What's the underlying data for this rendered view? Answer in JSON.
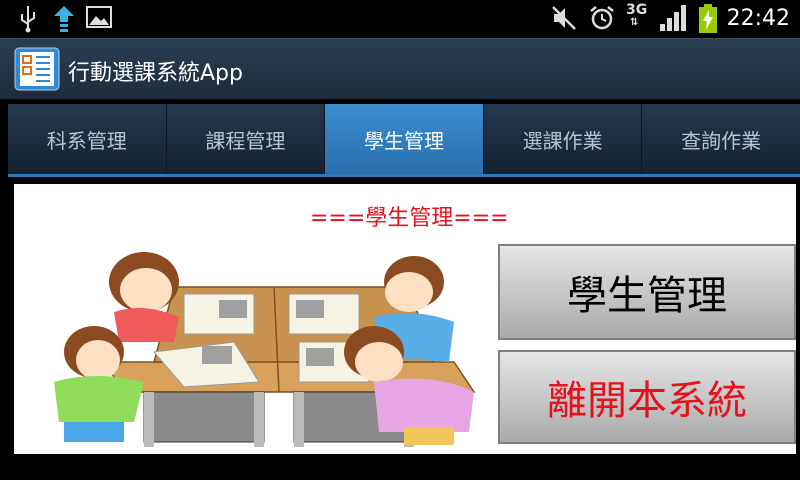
{
  "status_bar": {
    "time": "22:42",
    "network": "3G",
    "icons": [
      "usb-icon",
      "upload-icon",
      "image-icon",
      "mute-icon",
      "alarm-icon",
      "3g-icon",
      "signal-icon",
      "battery-charging-icon"
    ]
  },
  "app": {
    "title": "行動選課系統App"
  },
  "tabs": [
    {
      "label": "科系管理",
      "active": false
    },
    {
      "label": "課程管理",
      "active": false
    },
    {
      "label": "學生管理",
      "active": true
    },
    {
      "label": "選課作業",
      "active": false
    },
    {
      "label": "查詢作業",
      "active": false
    }
  ],
  "main": {
    "heading": "===學生管理===",
    "buttons": {
      "student_manage": "學生管理",
      "exit": "離開本系統"
    }
  },
  "colors": {
    "accent": "#2f7ab8",
    "heading": "#e8101a"
  }
}
